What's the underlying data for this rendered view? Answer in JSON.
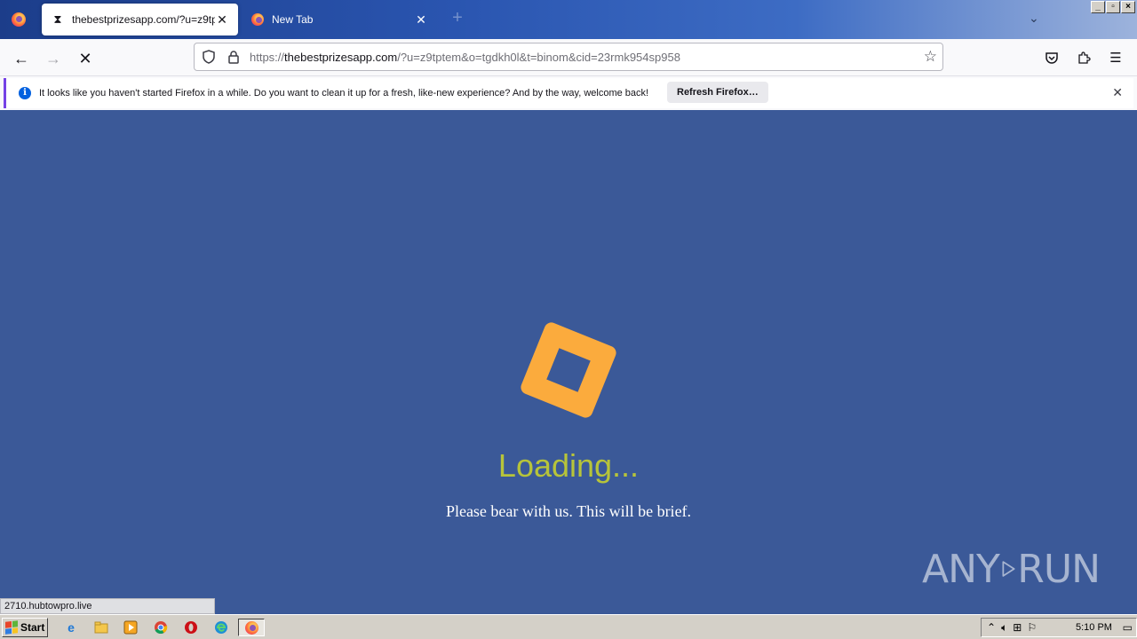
{
  "browser": {
    "tabs": [
      {
        "title": "thebestprizesapp.com/?u=z9tptem",
        "favicon": "hourglass-icon",
        "active": true
      },
      {
        "title": "New Tab",
        "favicon": "firefox-icon",
        "active": false
      }
    ],
    "url": {
      "scheme": "https://",
      "host": "thebestprizesapp.com",
      "path": "/?u=z9tptem&o=tgdkh0l&t=binom&cid=23rmk954sp958"
    },
    "notification": {
      "message": "It looks like you haven't started Firefox in a while. Do you want to clean it up for a fresh, like-new experience? And by the way, welcome back!",
      "button": "Refresh Firefox…"
    },
    "status_url": "2710.hubtowpro.live"
  },
  "page": {
    "loading_text": "Loading...",
    "subtext": "Please bear with us. This will be brief.",
    "loader_color": "#fbab3d",
    "background_color": "#3b5998"
  },
  "watermark": {
    "left": "ANY",
    "right": "RUN"
  },
  "taskbar": {
    "start_label": "Start",
    "clock": "5:10 PM"
  }
}
